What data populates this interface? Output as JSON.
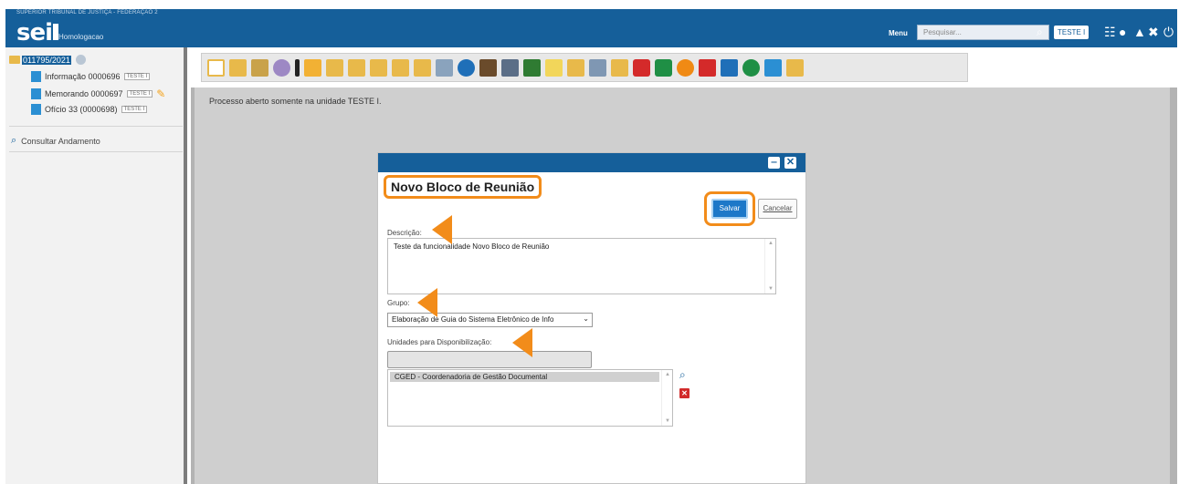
{
  "header": {
    "org": "SUPERIOR TRIBUNAL DE JUSTIÇA - FEDERAÇÃO 2",
    "logo": "sei",
    "environment": "Homologacao",
    "menu_label": "Menu",
    "search_placeholder": "Pesquisar...",
    "unit": "TESTE I",
    "icons": [
      "search-icon",
      "grid-icon",
      "info-icon",
      "user-icon",
      "tools-icon",
      "power-icon"
    ]
  },
  "tree": {
    "process_number": "011795/2021",
    "documents": [
      {
        "label": "Informação 0000696",
        "tag": "TESTE I"
      },
      {
        "label": "Memorando 0000697",
        "tag": "TESTE I"
      },
      {
        "label": "Ofício 33 (0000698)",
        "tag": "TESTE I"
      }
    ],
    "consult_label": "Consultar Andamento"
  },
  "content": {
    "status_text": "Processo aberto somente na unidade TESTE I."
  },
  "dialog": {
    "title": "Novo Bloco de Reunião",
    "save_label": "Salvar",
    "cancel_label": "Cancelar",
    "description_label": "Descrição:",
    "description_value": "Teste da funcionalidade Novo Bloco de Reunião",
    "group_label": "Grupo:",
    "group_value": "Elaboração de Guia do Sistema Eletrônico de Info",
    "units_label": "Unidades para Disponibilização:",
    "units": [
      "CGED - Coordenadoria de Gestão Documental"
    ]
  },
  "colors": {
    "brand": "#155f9a",
    "highlight": "#f28c1a",
    "save": "#1d78c8"
  }
}
